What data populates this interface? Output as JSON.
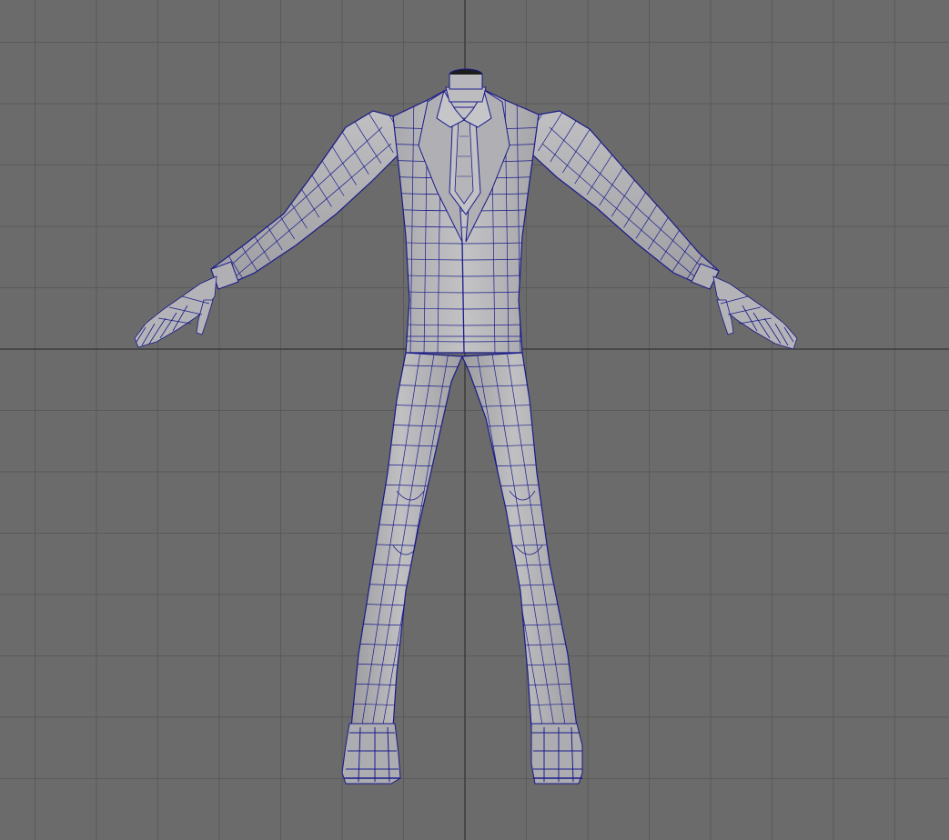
{
  "viewport": {
    "background": "#6b6b6b",
    "grid_color": "#5a5a5a",
    "axis_color": "#3c3c3c",
    "grid_visible": true
  },
  "model": {
    "shading": "wireframe-on-shaded",
    "surface_color": "#b9b9bc",
    "surface_shadow": "#9c9ca0",
    "wire_color": "#1a1a8a",
    "parts": [
      "neck-opening",
      "collar",
      "necktie",
      "jacket",
      "left-sleeve",
      "right-sleeve",
      "left-hand",
      "right-hand",
      "left-trouser-leg",
      "right-trouser-leg",
      "left-shoe",
      "right-shoe"
    ]
  }
}
